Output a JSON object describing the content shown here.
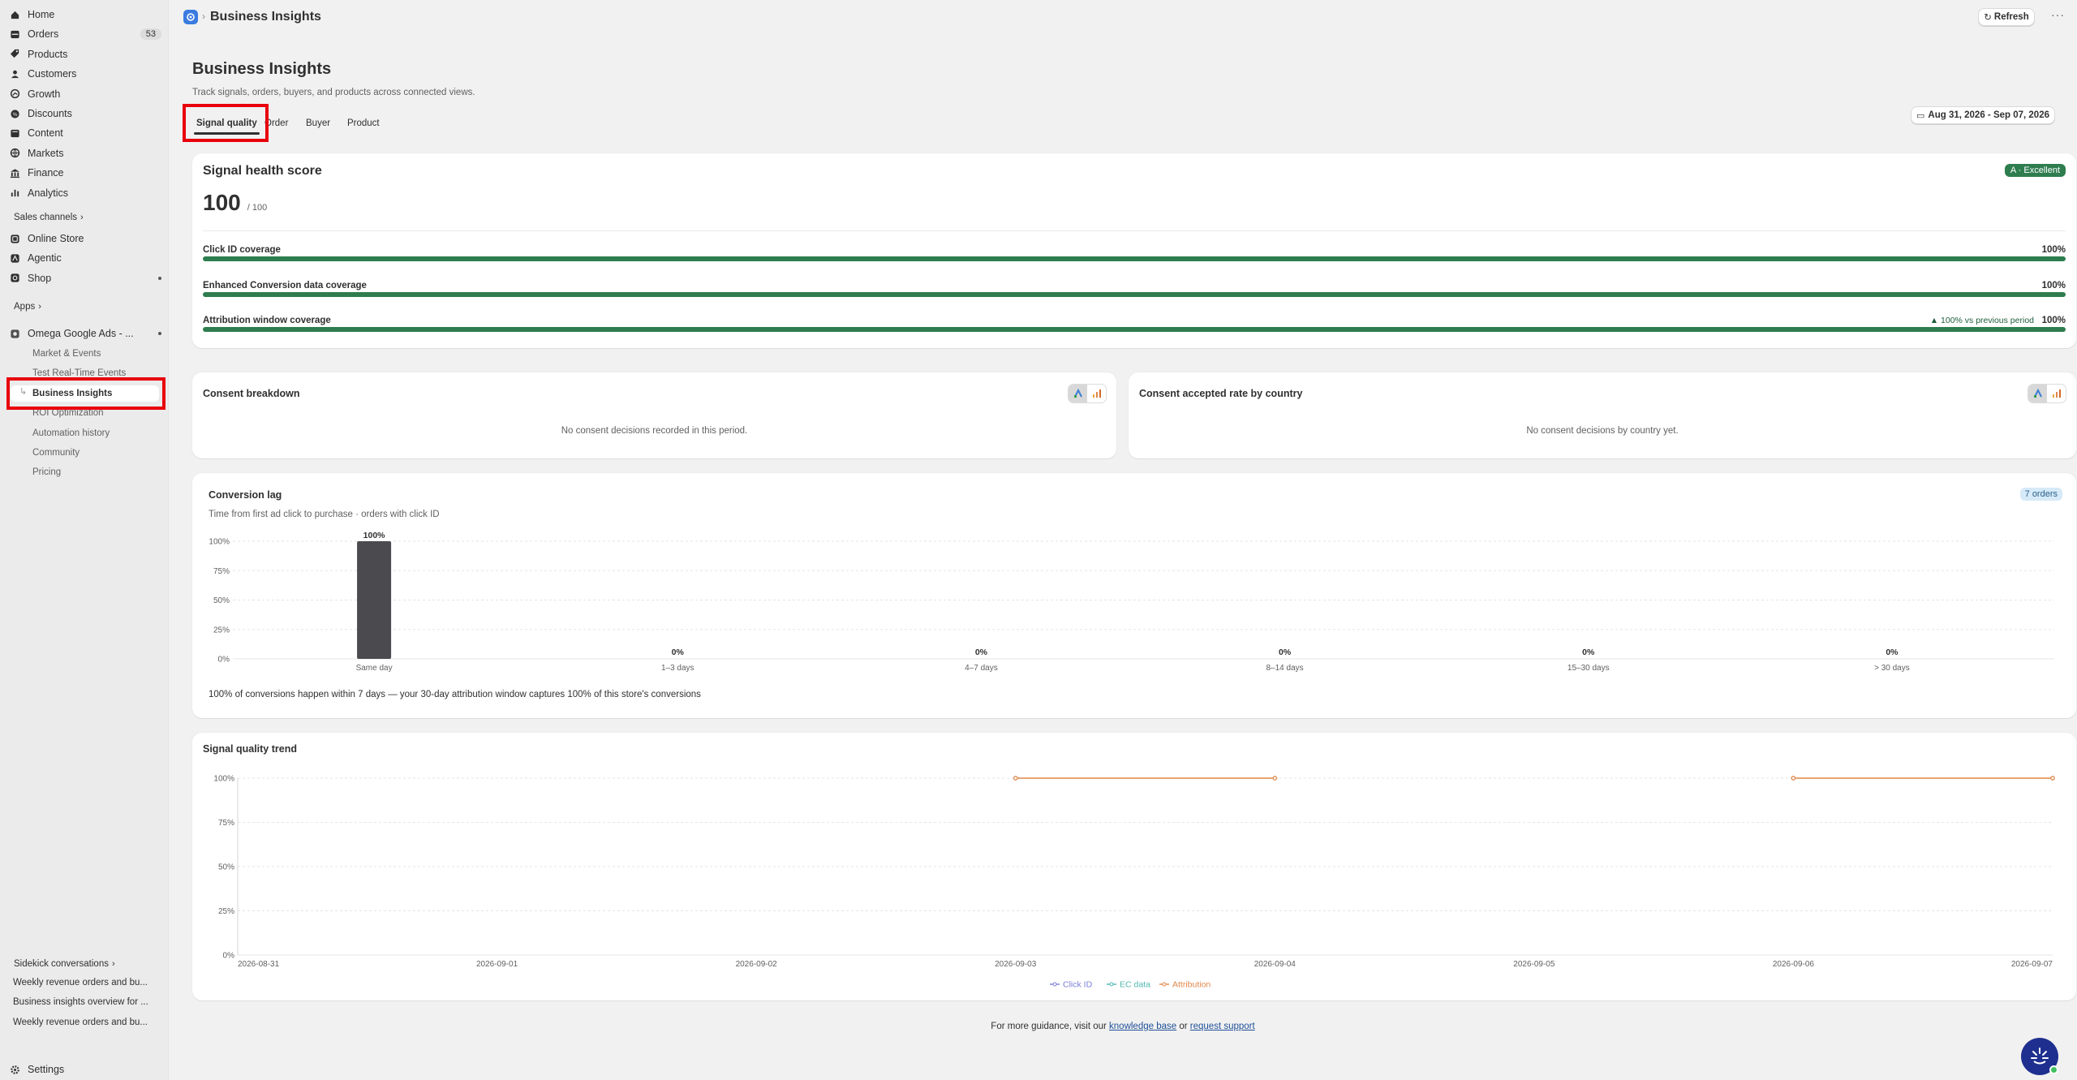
{
  "sidebar": {
    "main_items": [
      {
        "label": "Home",
        "icon": "home-icon"
      },
      {
        "label": "Orders",
        "icon": "orders-icon",
        "badge": "53"
      },
      {
        "label": "Products",
        "icon": "tag-icon"
      },
      {
        "label": "Customers",
        "icon": "person-icon"
      },
      {
        "label": "Growth",
        "icon": "growth-icon"
      },
      {
        "label": "Discounts",
        "icon": "discount-icon"
      },
      {
        "label": "Content",
        "icon": "content-icon"
      },
      {
        "label": "Markets",
        "icon": "globe-icon"
      },
      {
        "label": "Finance",
        "icon": "bank-icon"
      },
      {
        "label": "Analytics",
        "icon": "analytics-icon"
      }
    ],
    "sales_channels_label": "Sales channels",
    "sales_channels": [
      {
        "label": "Online Store",
        "icon": "store-icon"
      },
      {
        "label": "Agentic",
        "icon": "agentic-icon"
      },
      {
        "label": "Shop",
        "icon": "shop-icon"
      }
    ],
    "apps_label": "Apps",
    "app_name": "Omega Google Ads - ...",
    "app_sub_items": [
      "Market & Events",
      "Test Real-Time Events",
      "Business Insights",
      "ROI Optimization",
      "Automation history",
      "Community",
      "Pricing"
    ],
    "sidekick_label": "Sidekick conversations",
    "sidekick_items": [
      "Weekly revenue orders and bu...",
      "Business insights overview for ...",
      "Weekly revenue orders and bu..."
    ],
    "settings_label": "Settings"
  },
  "header": {
    "breadcrumb_title": "Business Insights",
    "refresh_label": "Refresh",
    "more_label": "···"
  },
  "page": {
    "title": "Business Insights",
    "subtitle": "Track signals, orders, buyers, and products across connected views.",
    "tabs": [
      "Signal quality",
      "Order",
      "Buyer",
      "Product"
    ],
    "date_range": "Aug 31, 2026 - Sep 07, 2026"
  },
  "health": {
    "title": "Signal health score",
    "score": "100",
    "score_max": "/ 100",
    "grade": "A · Excellent",
    "metrics": [
      {
        "label": "Click ID coverage",
        "value": "100%",
        "fill": 1.0
      },
      {
        "label": "Enhanced Conversion data coverage",
        "value": "100%",
        "fill": 1.0
      },
      {
        "label": "Attribution window coverage",
        "value": "100%",
        "fill": 1.0,
        "delta": "▲ 100% vs previous period"
      }
    ]
  },
  "consent": {
    "title": "Consent breakdown",
    "empty": "No consent decisions recorded in this period."
  },
  "consent_country": {
    "title": "Consent accepted rate by country",
    "empty": "No consent decisions by country yet."
  },
  "conversion_lag": {
    "title": "Conversion lag",
    "subtitle": "Time from first ad click to purchase · orders with click ID",
    "badge": "7 orders",
    "footer": "100% of conversions happen within 7 days — your 30-day attribution window captures 100% of this store's conversions"
  },
  "trend": {
    "title": "Signal quality trend"
  },
  "footer": {
    "prefix": "For more guidance, visit our ",
    "kb": "knowledge base",
    "or": " or ",
    "support": "request support"
  },
  "colors": {
    "bar_green": "#2e7d4f",
    "lag_bar": "#4a4a4f",
    "click_id": "#7b7fd6",
    "ec_data": "#4fb7b1",
    "attribution": "#e0874a",
    "badge_green": "#2e7d4f"
  },
  "chart_data": [
    {
      "type": "bar",
      "title": "Conversion lag",
      "categories": [
        "Same day",
        "1–3 days",
        "4–7 days",
        "8–14 days",
        "15–30 days",
        "> 30 days"
      ],
      "values": [
        100,
        0,
        0,
        0,
        0,
        0
      ],
      "value_labels": [
        "100%",
        "0%",
        "0%",
        "0%",
        "0%",
        "0%"
      ],
      "yticks": [
        "0%",
        "25%",
        "50%",
        "75%",
        "100%"
      ],
      "ylim": [
        0,
        100
      ],
      "grid": true
    },
    {
      "type": "line",
      "title": "Signal quality trend",
      "x": [
        "2026-08-31",
        "2026-09-01",
        "2026-09-02",
        "2026-09-03",
        "2026-09-04",
        "2026-09-05",
        "2026-09-06",
        "2026-09-07"
      ],
      "yticks": [
        "0%",
        "25%",
        "50%",
        "75%",
        "100%"
      ],
      "ylim": [
        0,
        100
      ],
      "series": [
        {
          "name": "Click ID",
          "values": [
            null,
            null,
            null,
            null,
            null,
            null,
            null,
            null
          ]
        },
        {
          "name": "EC data",
          "values": [
            null,
            null,
            null,
            null,
            null,
            null,
            null,
            null
          ]
        },
        {
          "name": "Attribution",
          "values": [
            null,
            null,
            null,
            100,
            100,
            null,
            100,
            100
          ]
        }
      ],
      "legend": "bottom-center",
      "grid": true
    }
  ]
}
